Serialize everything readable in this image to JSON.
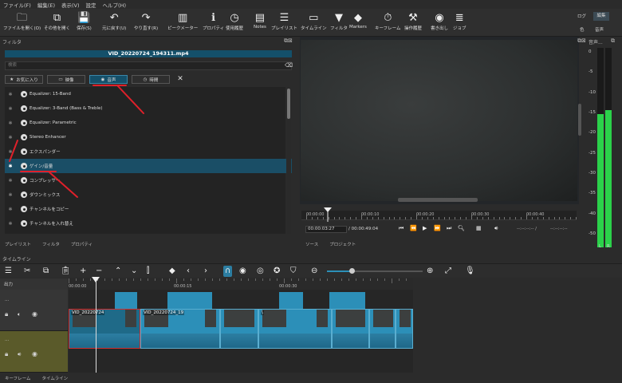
{
  "menu": [
    "ファイル(F)",
    "編集(E)",
    "表示(V)",
    "設定",
    "ヘルプ(H)"
  ],
  "toolbar": [
    {
      "label": "ファイルを開く(O)",
      "icon": "folder-icon",
      "glyph": "🗀"
    },
    {
      "label": "その他を開く",
      "icon": "open-other-icon",
      "glyph": "⧉"
    },
    {
      "label": "保存(S)",
      "icon": "save-icon",
      "glyph": "💾"
    },
    {
      "label": "元に戻す(U)",
      "icon": "undo-icon",
      "glyph": "↶"
    },
    {
      "label": "やり直す(R)",
      "icon": "redo-icon",
      "glyph": "↷"
    },
    {
      "label": "ピークメーター",
      "icon": "peak-meter-icon",
      "glyph": "▥"
    },
    {
      "label": "プロパティ",
      "icon": "info-icon",
      "glyph": "ℹ"
    },
    {
      "label": "使用履歴",
      "icon": "history-icon",
      "glyph": "◷"
    },
    {
      "label": "Notes",
      "icon": "notes-icon",
      "glyph": "▤"
    },
    {
      "label": "プレイリスト",
      "icon": "playlist-icon",
      "glyph": "☰"
    },
    {
      "label": "タイムライン",
      "icon": "timeline-icon",
      "glyph": "▭"
    },
    {
      "label": "フィルタ",
      "icon": "filter-icon",
      "glyph": "▼"
    },
    {
      "label": "Markers",
      "icon": "marker-icon",
      "glyph": "◆"
    },
    {
      "label": "キーフレーム",
      "icon": "stopwatch-icon",
      "glyph": "⏱"
    },
    {
      "label": "操作履歴",
      "icon": "action-history-icon",
      "glyph": "⚒"
    },
    {
      "label": "書き出し",
      "icon": "export-icon",
      "glyph": "◉"
    },
    {
      "label": "ジョブ",
      "icon": "jobs-icon",
      "glyph": "≣"
    }
  ],
  "layouts": {
    "log": "ログ",
    "edit": "編集",
    "color": "色",
    "audio": "音声"
  },
  "filter_panel": {
    "header": "フィルタ",
    "clip_title": "VID_20220724_194311.mp4",
    "search_placeholder": "検索",
    "tabs": {
      "favorites": "お気に入り",
      "video": "映像",
      "audio": "音声",
      "time": "時間"
    },
    "items": [
      "Equalizer: 15-Band",
      "Equalizer: 3-Band (Bass & Treble)",
      "Equalizer: Parametric",
      "Stereo Enhancer",
      "エクスパンダー",
      "ゲイン/音量",
      "コンプレッサー",
      "ダウンミックス",
      "チャンネルをコピー",
      "チャンネルを入れ替え"
    ],
    "selected_index": 5,
    "bottom_tabs": [
      "プレイリスト",
      "フィルタ",
      "プロパティ"
    ]
  },
  "player": {
    "ruler_ticks": [
      "00:00:00",
      "00:00:10",
      "00:00:20",
      "00:00:30",
      "00:00:40"
    ],
    "position": "00:00:03:27",
    "duration": "/ 00:00:49:04",
    "in_point": "--:--:--:-- /",
    "out_point": "--:--:--:--",
    "bottom_tabs": [
      "ソース",
      "プロジェクト"
    ]
  },
  "audio_meter": {
    "header": "音声...",
    "scale": [
      "0",
      "-5",
      "-10",
      "-15",
      "-20",
      "-25",
      "-30",
      "-35",
      "-40",
      "-50"
    ],
    "channels": [
      "L",
      "R"
    ],
    "level_left_db": -16,
    "level_right_db": -15
  },
  "timeline": {
    "header": "タイムライン",
    "output_label": "出力",
    "ruler": [
      "00:00:00",
      "00:00:15",
      "00:00:30"
    ],
    "track1_name": "...",
    "track2_name": "...",
    "clip_name": "VID_20220724",
    "clip_name_long": "VID_20220724_19",
    "clip_name_short": "\\"
  },
  "status_tabs": [
    "キーフレーム",
    "タイムライン"
  ],
  "colors": {
    "accent": "#14506a",
    "selected_row": "#1a4e66",
    "clip": "#2c8fb8",
    "audio_track": "#5a5a2a",
    "annotation": "#e0202a",
    "meter": "#2bd14a"
  }
}
